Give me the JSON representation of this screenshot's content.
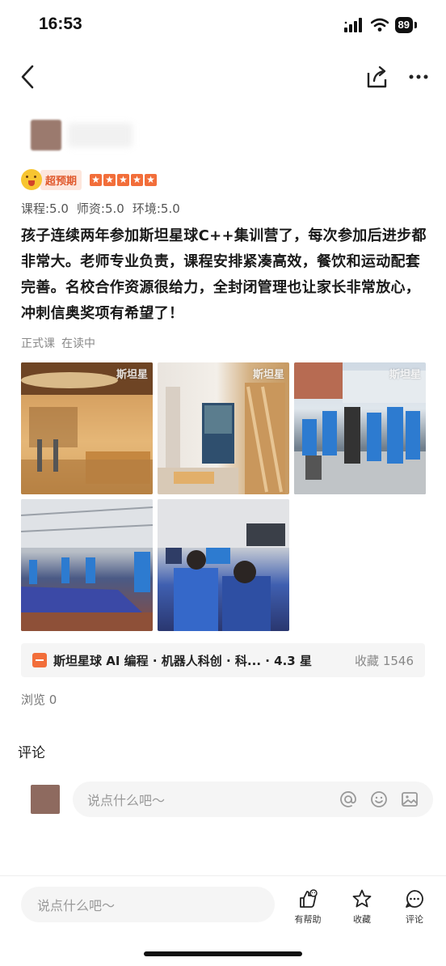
{
  "status_bar": {
    "time": "16:53",
    "battery": "89",
    "icons": [
      "signal-icon",
      "wifi-icon",
      "battery-icon"
    ]
  },
  "nav": {
    "icons": [
      "back-icon",
      "share-icon",
      "more-icon"
    ]
  },
  "review": {
    "badge_label": "超预期",
    "star_count": 5,
    "scores": {
      "course": "课程:5.0",
      "teacher": "师资:5.0",
      "environment": "环境:5.0"
    },
    "text": "孩子连续两年参加斯坦星球C++集训营了，每次参加后进步都非常大。老师专业负责，课程安排紧凑高效，餐饮和运动配套完善。名校合作资源很给力，全封闭管理也让家长非常放心，冲刺信奥奖项有希望了！",
    "tags": [
      "正式课",
      "在读中"
    ],
    "photo_watermark": "斯坦星"
  },
  "institution": {
    "name": "斯坦星球 AI 编程 · 机器人科创 · 科... · 4.3 星",
    "favorites": "收藏 1546"
  },
  "views": "浏览 0",
  "comments": {
    "title": "评论",
    "placeholder": "说点什么吧～"
  },
  "bottom_bar": {
    "placeholder": "说点什么吧～",
    "helpful": "有帮助",
    "collect": "收藏",
    "comment": "评论"
  },
  "colors": {
    "accent": "#f26e3a",
    "badge_bg": "#fde6dc",
    "input_bg": "#f5f5f5"
  }
}
